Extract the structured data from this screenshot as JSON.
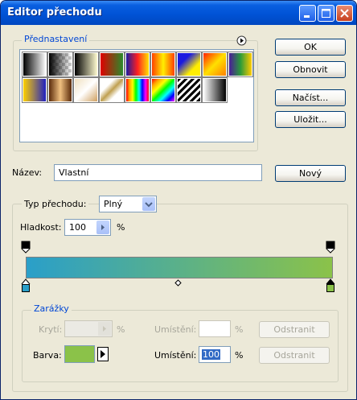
{
  "window": {
    "title": "Editor přechodu",
    "controls": [
      "minimize-icon",
      "maximize-icon",
      "close-icon"
    ]
  },
  "presets": {
    "legend": "Přednastavení",
    "menu_icon": "circle-arrow-right-icon",
    "swatches": [
      "linear-gradient(to right,#000,#fff)",
      "checker",
      "linear-gradient(to right,#000,#fffbd0)",
      "linear-gradient(to right,#e00000,#2a8a2a)",
      "linear-gradient(to right,#1a1aa0,#ff2020,#ffe000)",
      "linear-gradient(to right,#ff4000,#ffee00,#ff4000)",
      "linear-gradient(135deg,#1a1ae0 30%,#ffee00 70%)",
      "linear-gradient(135deg,#ff2000,#ffe000,#ff8000)",
      "linear-gradient(to right,#4b1a9a,#2a9a3a,#ffcc00)",
      "linear-gradient(to right,#ffd000,#2020c0)",
      "linear-gradient(to right,#5a2a0a,#f0c080,#5a2a0a)",
      "linear-gradient(135deg,#f0e0c0,#ffffff,#d0a060)",
      "linear-gradient(135deg,#ffffff 30%,#c0a050 50%,#ffffff 70%)",
      "linear-gradient(to right,red,orange,yellow,lime,cyan,blue,magenta,red)",
      "linear-gradient(135deg,red,orange,yellow,lime,cyan,blue,magenta)",
      "stripes",
      "linear-gradient(to right,#ffffff,#000000)"
    ]
  },
  "buttons": {
    "ok": "OK",
    "cancel": "Obnovit",
    "load": "Načíst...",
    "save": "Uložit...",
    "new": "Nový"
  },
  "name": {
    "label": "Název:",
    "value": "Vlastní"
  },
  "gradient": {
    "type_label": "Typ přechodu:",
    "type_value": "Plný",
    "smoothness_label": "Hladkost:",
    "smoothness_value": "100",
    "smoothness_unit": "%",
    "colors": [
      "#2a9fc9",
      "#8bc249"
    ],
    "color_stop_left": "#2a9fc9",
    "color_stop_right": "#8bc249"
  },
  "stops": {
    "legend": "Zarážky",
    "opacity_label": "Krytí:",
    "opacity_unit": "%",
    "opacity_location_label": "Umístění:",
    "opacity_location_unit": "%",
    "opacity_delete": "Odstranit",
    "color_label": "Barva:",
    "color_swatch": "#8bc249",
    "color_location_label": "Umístění:",
    "color_location_value": "100",
    "color_location_unit": "%",
    "color_delete": "Odstranit"
  }
}
